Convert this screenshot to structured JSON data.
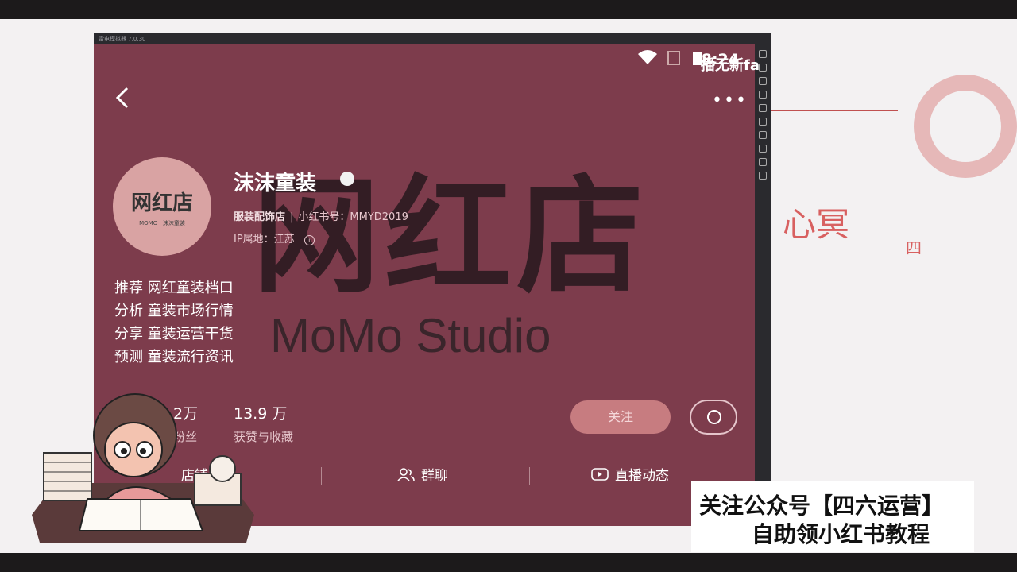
{
  "emulator": {
    "title": "雷电模拟器 7.0.30"
  },
  "status_bar": {
    "time": "8:24"
  },
  "overlay_text": "播无新fa",
  "profile": {
    "name": "沫沫童装",
    "category": "服装配饰店",
    "xhs_id_label": "小红书号：MMYD2019",
    "ip_label": "IP属地：江苏",
    "avatar_title": "网红店",
    "avatar_sub": "MOMO · 沫沫童装"
  },
  "cover": {
    "brand_big": "网红店",
    "brand_en": "MoMo Studio"
  },
  "bio": [
    "推荐 网红童装档口",
    "分析 童装市场行情",
    "分享 童装运营干货",
    "预测 童装流行资讯"
  ],
  "stats": {
    "fans_num": "2万",
    "fans_label": "粉丝",
    "likes_num": "13.9 万",
    "likes_label": "获赞与收藏"
  },
  "actions": {
    "follow": "关注"
  },
  "tabs": {
    "shop": "店铺",
    "group": "群聊",
    "live": "直播动态"
  },
  "banner": {
    "line1": "关注公众号【四六运营】",
    "line2": "自助领小红书教程"
  },
  "background": {
    "handwriting": "心冥",
    "handwriting2": "四"
  },
  "colors": {
    "phone_bg": "#7d3c4c",
    "follow_btn": "#c77c80"
  }
}
